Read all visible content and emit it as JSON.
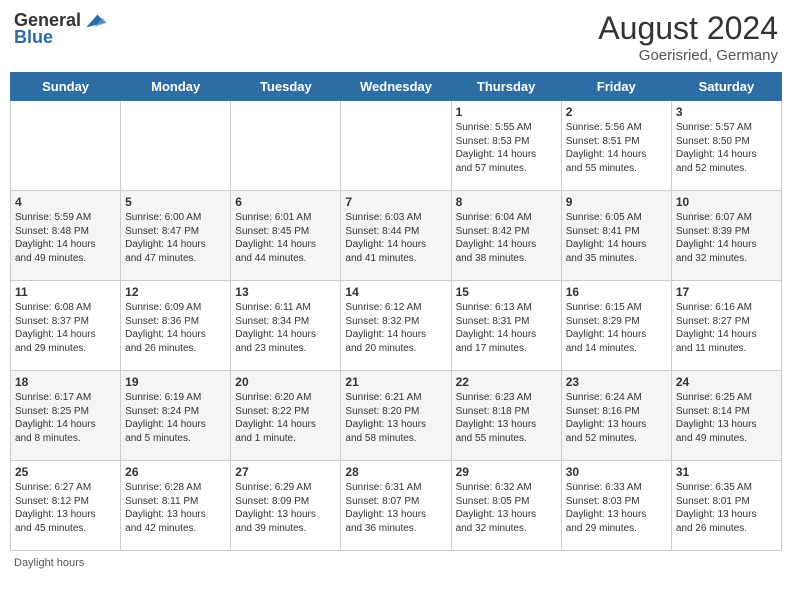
{
  "header": {
    "logo_general": "General",
    "logo_blue": "Blue",
    "month_year": "August 2024",
    "location": "Goerisried, Germany"
  },
  "days_of_week": [
    "Sunday",
    "Monday",
    "Tuesday",
    "Wednesday",
    "Thursday",
    "Friday",
    "Saturday"
  ],
  "footer": {
    "text": "Daylight hours"
  },
  "weeks": [
    {
      "days": [
        {
          "num": "",
          "info": ""
        },
        {
          "num": "",
          "info": ""
        },
        {
          "num": "",
          "info": ""
        },
        {
          "num": "",
          "info": ""
        },
        {
          "num": "1",
          "info": "Sunrise: 5:55 AM\nSunset: 8:53 PM\nDaylight: 14 hours\nand 57 minutes."
        },
        {
          "num": "2",
          "info": "Sunrise: 5:56 AM\nSunset: 8:51 PM\nDaylight: 14 hours\nand 55 minutes."
        },
        {
          "num": "3",
          "info": "Sunrise: 5:57 AM\nSunset: 8:50 PM\nDaylight: 14 hours\nand 52 minutes."
        }
      ]
    },
    {
      "days": [
        {
          "num": "4",
          "info": "Sunrise: 5:59 AM\nSunset: 8:48 PM\nDaylight: 14 hours\nand 49 minutes."
        },
        {
          "num": "5",
          "info": "Sunrise: 6:00 AM\nSunset: 8:47 PM\nDaylight: 14 hours\nand 47 minutes."
        },
        {
          "num": "6",
          "info": "Sunrise: 6:01 AM\nSunset: 8:45 PM\nDaylight: 14 hours\nand 44 minutes."
        },
        {
          "num": "7",
          "info": "Sunrise: 6:03 AM\nSunset: 8:44 PM\nDaylight: 14 hours\nand 41 minutes."
        },
        {
          "num": "8",
          "info": "Sunrise: 6:04 AM\nSunset: 8:42 PM\nDaylight: 14 hours\nand 38 minutes."
        },
        {
          "num": "9",
          "info": "Sunrise: 6:05 AM\nSunset: 8:41 PM\nDaylight: 14 hours\nand 35 minutes."
        },
        {
          "num": "10",
          "info": "Sunrise: 6:07 AM\nSunset: 8:39 PM\nDaylight: 14 hours\nand 32 minutes."
        }
      ]
    },
    {
      "days": [
        {
          "num": "11",
          "info": "Sunrise: 6:08 AM\nSunset: 8:37 PM\nDaylight: 14 hours\nand 29 minutes."
        },
        {
          "num": "12",
          "info": "Sunrise: 6:09 AM\nSunset: 8:36 PM\nDaylight: 14 hours\nand 26 minutes."
        },
        {
          "num": "13",
          "info": "Sunrise: 6:11 AM\nSunset: 8:34 PM\nDaylight: 14 hours\nand 23 minutes."
        },
        {
          "num": "14",
          "info": "Sunrise: 6:12 AM\nSunset: 8:32 PM\nDaylight: 14 hours\nand 20 minutes."
        },
        {
          "num": "15",
          "info": "Sunrise: 6:13 AM\nSunset: 8:31 PM\nDaylight: 14 hours\nand 17 minutes."
        },
        {
          "num": "16",
          "info": "Sunrise: 6:15 AM\nSunset: 8:29 PM\nDaylight: 14 hours\nand 14 minutes."
        },
        {
          "num": "17",
          "info": "Sunrise: 6:16 AM\nSunset: 8:27 PM\nDaylight: 14 hours\nand 11 minutes."
        }
      ]
    },
    {
      "days": [
        {
          "num": "18",
          "info": "Sunrise: 6:17 AM\nSunset: 8:25 PM\nDaylight: 14 hours\nand 8 minutes."
        },
        {
          "num": "19",
          "info": "Sunrise: 6:19 AM\nSunset: 8:24 PM\nDaylight: 14 hours\nand 5 minutes."
        },
        {
          "num": "20",
          "info": "Sunrise: 6:20 AM\nSunset: 8:22 PM\nDaylight: 14 hours\nand 1 minute."
        },
        {
          "num": "21",
          "info": "Sunrise: 6:21 AM\nSunset: 8:20 PM\nDaylight: 13 hours\nand 58 minutes."
        },
        {
          "num": "22",
          "info": "Sunrise: 6:23 AM\nSunset: 8:18 PM\nDaylight: 13 hours\nand 55 minutes."
        },
        {
          "num": "23",
          "info": "Sunrise: 6:24 AM\nSunset: 8:16 PM\nDaylight: 13 hours\nand 52 minutes."
        },
        {
          "num": "24",
          "info": "Sunrise: 6:25 AM\nSunset: 8:14 PM\nDaylight: 13 hours\nand 49 minutes."
        }
      ]
    },
    {
      "days": [
        {
          "num": "25",
          "info": "Sunrise: 6:27 AM\nSunset: 8:12 PM\nDaylight: 13 hours\nand 45 minutes."
        },
        {
          "num": "26",
          "info": "Sunrise: 6:28 AM\nSunset: 8:11 PM\nDaylight: 13 hours\nand 42 minutes."
        },
        {
          "num": "27",
          "info": "Sunrise: 6:29 AM\nSunset: 8:09 PM\nDaylight: 13 hours\nand 39 minutes."
        },
        {
          "num": "28",
          "info": "Sunrise: 6:31 AM\nSunset: 8:07 PM\nDaylight: 13 hours\nand 36 minutes."
        },
        {
          "num": "29",
          "info": "Sunrise: 6:32 AM\nSunset: 8:05 PM\nDaylight: 13 hours\nand 32 minutes."
        },
        {
          "num": "30",
          "info": "Sunrise: 6:33 AM\nSunset: 8:03 PM\nDaylight: 13 hours\nand 29 minutes."
        },
        {
          "num": "31",
          "info": "Sunrise: 6:35 AM\nSunset: 8:01 PM\nDaylight: 13 hours\nand 26 minutes."
        }
      ]
    }
  ]
}
